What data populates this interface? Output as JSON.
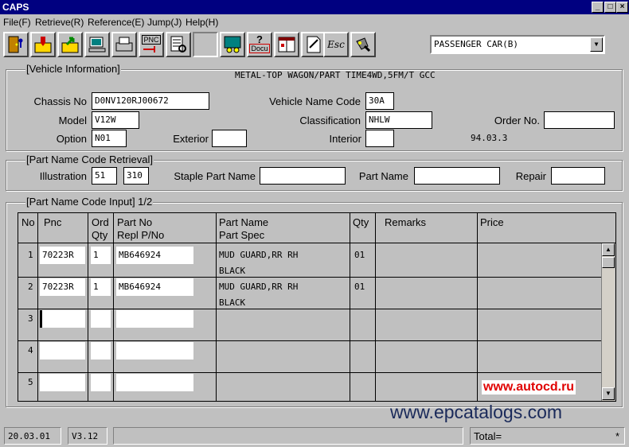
{
  "window": {
    "title": "CAPS"
  },
  "menu": [
    "File(F)",
    "Retrieve(R)",
    "Reference(E)",
    "Jump(J)",
    "Help(H)"
  ],
  "toolbar": {
    "pnc_label": "PNC",
    "docu_label": "Docu",
    "esc_label": "Esc",
    "help_mark": "?"
  },
  "car_type": {
    "value": "PASSENGER CAR(B)"
  },
  "vehicle": {
    "title": "[Vehicle Information]",
    "description": "METAL-TOP WAGON/PART TIME4WD,5FM/T    GCC",
    "chassis_label": "Chassis No",
    "chassis": "D0NV120RJ00672",
    "vname_label": "Vehicle Name Code",
    "vname": "30A",
    "model_label": "Model",
    "model": "V12W",
    "class_label": "Classification",
    "class": "NHLW",
    "order_label": "Order No.",
    "order": "",
    "option_label": "Option",
    "option": "N01",
    "exterior_label": "Exterior",
    "exterior": "",
    "interior_label": "Interior",
    "interior": "",
    "date": "94.03.3"
  },
  "retrieval": {
    "title": "[Part Name Code Retrieval]",
    "illus_label": "Illustration",
    "illus1": "51",
    "illus2": "310",
    "staple_label": "Staple Part Name",
    "partname_label": "Part Name",
    "repair_label": "Repair"
  },
  "input": {
    "title": "[Part Name Code Input] 1/2",
    "headers": {
      "no": "No",
      "pnc": "Pnc",
      "ord1": "Ord",
      "ord2": "Qty",
      "partno1": "Part No",
      "partno2": "Repl P/No",
      "pname1": "Part Name",
      "pname2": "Part Spec",
      "qty": "Qty",
      "remarks": "Remarks",
      "price": "Price"
    },
    "rows": [
      {
        "no": "1",
        "pnc": "70223R",
        "ord": "1",
        "partno": "MB646924",
        "name": "MUD GUARD,RR RH",
        "spec": "BLACK",
        "qty": "01"
      },
      {
        "no": "2",
        "pnc": "70223R",
        "ord": "1",
        "partno": "MB646924",
        "name": "MUD GUARD,RR RH",
        "spec": "BLACK",
        "qty": "01"
      },
      {
        "no": "3",
        "pnc": "",
        "ord": "",
        "partno": "",
        "name": "",
        "spec": "",
        "qty": ""
      },
      {
        "no": "4",
        "pnc": "",
        "ord": "",
        "partno": "",
        "name": "",
        "spec": "",
        "qty": ""
      },
      {
        "no": "5",
        "pnc": "",
        "ord": "",
        "partno": "",
        "name": "",
        "spec": "",
        "qty": ""
      }
    ]
  },
  "watermarks": {
    "autocd": "www.autocd.ru",
    "epc": "www.epcatalogs.com"
  },
  "status": {
    "date": "20.03.01",
    "version": "V3.12",
    "message": "",
    "total": "Total=",
    "star": "*"
  }
}
